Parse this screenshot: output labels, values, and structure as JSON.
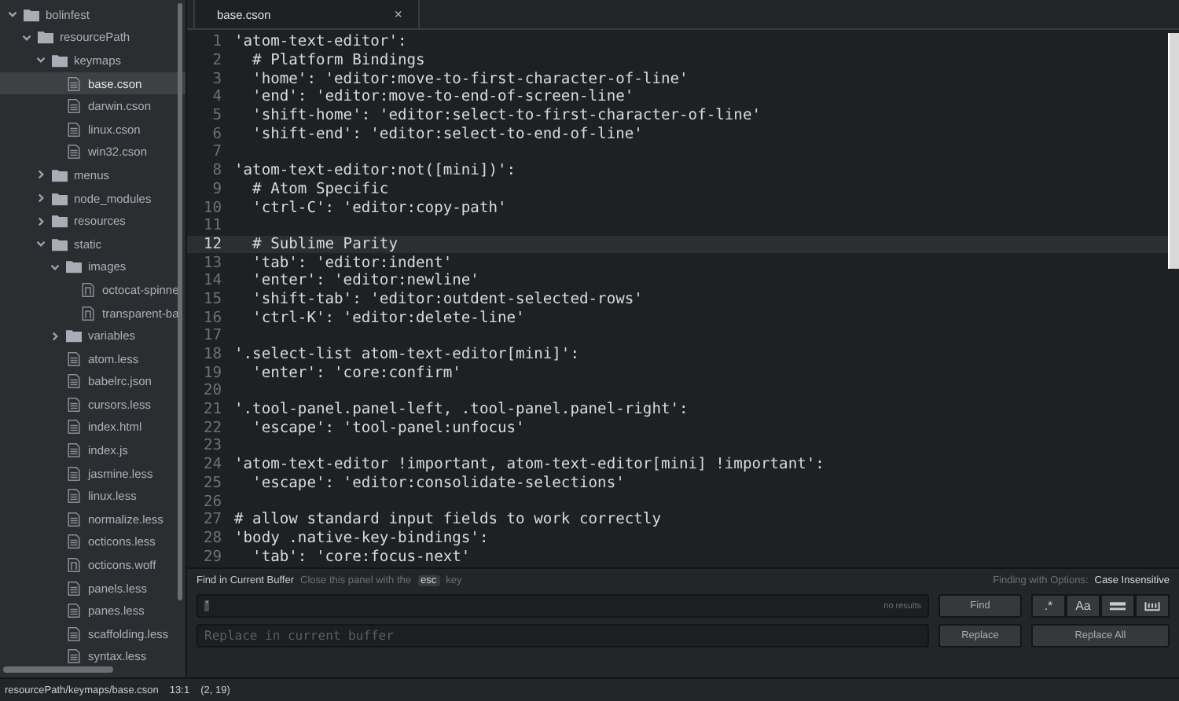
{
  "sidebar": {
    "items": [
      {
        "name": "bolinfest",
        "kind": "folder",
        "expanded": true,
        "selected": false,
        "children": [
          {
            "name": "resourcePath",
            "kind": "folder",
            "expanded": true,
            "selected": false,
            "children": [
              {
                "name": "keymaps",
                "kind": "folder",
                "expanded": true,
                "selected": false,
                "children": [
                  {
                    "name": "base.cson",
                    "kind": "file",
                    "selected": true
                  },
                  {
                    "name": "darwin.cson",
                    "kind": "file",
                    "selected": false
                  },
                  {
                    "name": "linux.cson",
                    "kind": "file",
                    "selected": false
                  },
                  {
                    "name": "win32.cson",
                    "kind": "file",
                    "selected": false
                  }
                ]
              },
              {
                "name": "menus",
                "kind": "folder",
                "expanded": false,
                "selected": false
              },
              {
                "name": "node_modules",
                "kind": "folder",
                "expanded": false,
                "selected": false
              },
              {
                "name": "resources",
                "kind": "folder",
                "expanded": false,
                "selected": false
              },
              {
                "name": "static",
                "kind": "folder",
                "expanded": true,
                "selected": false,
                "children": [
                  {
                    "name": "images",
                    "kind": "folder",
                    "expanded": true,
                    "selected": false,
                    "children": [
                      {
                        "name": "octocat-spinne",
                        "kind": "media",
                        "selected": false
                      },
                      {
                        "name": "transparent-ba",
                        "kind": "media",
                        "selected": false
                      }
                    ]
                  },
                  {
                    "name": "variables",
                    "kind": "folder",
                    "expanded": false,
                    "selected": false
                  },
                  {
                    "name": "atom.less",
                    "kind": "file",
                    "selected": false
                  },
                  {
                    "name": "babelrc.json",
                    "kind": "file",
                    "selected": false
                  },
                  {
                    "name": "cursors.less",
                    "kind": "file",
                    "selected": false
                  },
                  {
                    "name": "index.html",
                    "kind": "file",
                    "selected": false
                  },
                  {
                    "name": "index.js",
                    "kind": "file",
                    "selected": false
                  },
                  {
                    "name": "jasmine.less",
                    "kind": "file",
                    "selected": false
                  },
                  {
                    "name": "linux.less",
                    "kind": "file",
                    "selected": false
                  },
                  {
                    "name": "normalize.less",
                    "kind": "file",
                    "selected": false
                  },
                  {
                    "name": "octicons.less",
                    "kind": "file",
                    "selected": false
                  },
                  {
                    "name": "octicons.woff",
                    "kind": "media",
                    "selected": false
                  },
                  {
                    "name": "panels.less",
                    "kind": "file",
                    "selected": false
                  },
                  {
                    "name": "panes.less",
                    "kind": "file",
                    "selected": false
                  },
                  {
                    "name": "scaffolding.less",
                    "kind": "file",
                    "selected": false
                  },
                  {
                    "name": "syntax.less",
                    "kind": "file",
                    "selected": false
                  }
                ]
              }
            ]
          }
        ]
      }
    ]
  },
  "tabs": [
    {
      "title": "base.cson",
      "close": "×",
      "selected": true
    }
  ],
  "editor": {
    "lines": [
      {
        "number": "1",
        "text": "'atom-text-editor':",
        "current": false
      },
      {
        "number": "2",
        "text": "  # Platform Bindings",
        "current": false
      },
      {
        "number": "3",
        "text": "  'home': 'editor:move-to-first-character-of-line'",
        "current": false
      },
      {
        "number": "4",
        "text": "  'end': 'editor:move-to-end-of-screen-line'",
        "current": false
      },
      {
        "number": "5",
        "text": "  'shift-home': 'editor:select-to-first-character-of-line'",
        "current": false
      },
      {
        "number": "6",
        "text": "  'shift-end': 'editor:select-to-end-of-line'",
        "current": false
      },
      {
        "number": "7",
        "current": false
      },
      {
        "number": "8",
        "text": "'atom-text-editor:not([mini])':",
        "current": false
      },
      {
        "number": "9",
        "text": "  # Atom Specific",
        "current": false
      },
      {
        "number": "10",
        "text": "  'ctrl-C': 'editor:copy-path'",
        "current": false
      },
      {
        "number": "11",
        "current": false
      },
      {
        "number": "12",
        "text": "  # Sublime Parity",
        "current": true
      },
      {
        "number": "13",
        "text": "  'tab': 'editor:indent'",
        "current": false
      },
      {
        "number": "14",
        "text": "  'enter': 'editor:newline'",
        "current": false
      },
      {
        "number": "15",
        "text": "  'shift-tab': 'editor:outdent-selected-rows'",
        "current": false
      },
      {
        "number": "16",
        "text": "  'ctrl-K': 'editor:delete-line'",
        "current": false
      },
      {
        "number": "17",
        "current": false
      },
      {
        "number": "18",
        "text": "'.select-list atom-text-editor[mini]':",
        "current": false
      },
      {
        "number": "19",
        "text": "  'enter': 'core:confirm'",
        "current": false
      },
      {
        "number": "20",
        "current": false
      },
      {
        "number": "21",
        "text": "'.tool-panel.panel-left, .tool-panel.panel-right':",
        "current": false
      },
      {
        "number": "22",
        "text": "  'escape': 'tool-panel:unfocus'",
        "current": false
      },
      {
        "number": "23",
        "current": false
      },
      {
        "number": "24",
        "text": "'atom-text-editor !important, atom-text-editor[mini] !important':",
        "current": false
      },
      {
        "number": "25",
        "text": "  'escape': 'editor:consolidate-selections'",
        "current": false
      },
      {
        "number": "26",
        "current": false
      },
      {
        "number": "27",
        "text": "# allow standard input fields to work correctly",
        "current": false
      },
      {
        "number": "28",
        "text": "'body .native-key-bindings':",
        "current": false
      },
      {
        "number": "29",
        "text": "  'tab': 'core:focus-next'",
        "current": false
      }
    ]
  },
  "find_panel": {
    "title": "Find in Current Buffer",
    "hint": "Close this panel with the",
    "hint_key": "esc",
    "hint_end": "key",
    "options_label": "Finding with Options:",
    "options_value": "Case Insensitive",
    "find_field": {
      "value": "'",
      "result": "no results"
    },
    "find_button": "Find",
    "option_buttons": [
      {
        "kind": "regex",
        "label": ".*",
        "selected": false
      },
      {
        "kind": "case",
        "label": "Aa",
        "selected": false
      },
      {
        "kind": "selection",
        "selected": false
      },
      {
        "kind": "word",
        "selected": false
      }
    ],
    "replace_field": {
      "placeholder": "Replace in current buffer"
    },
    "replace_button": "Replace",
    "replace_all_button": "Replace All"
  },
  "status_bar": {
    "path": "resourcePath/keymaps/base.cson",
    "cursor": "13:1",
    "selection": "(2, 19)"
  }
}
